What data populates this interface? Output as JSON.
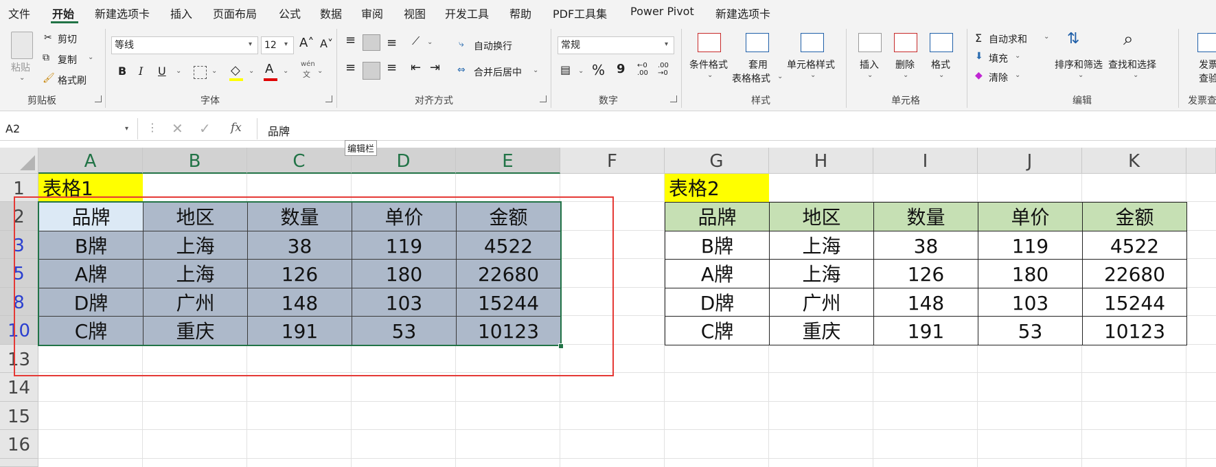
{
  "menu": {
    "tabs": [
      "文件",
      "开始",
      "新建选项卡",
      "插入",
      "页面布局",
      "公式",
      "数据",
      "审阅",
      "视图",
      "开发工具",
      "帮助",
      "PDF工具集",
      "Power Pivot",
      "新建选项卡"
    ],
    "active": "开始"
  },
  "ribbon": {
    "clipboard": {
      "paste": "粘贴",
      "cut": "剪切",
      "copy": "复制",
      "painter": "格式刷",
      "label": "剪贴板"
    },
    "font": {
      "name": "等线",
      "size": "12",
      "label": "字体",
      "bold": "B",
      "italic": "I",
      "underline": "U",
      "phonetic_top": "wén",
      "phonetic_bottom": "文",
      "font_color_letter": "A"
    },
    "align": {
      "wrap": "自动换行",
      "merge": "合并后居中",
      "label": "对齐方式"
    },
    "number": {
      "format": "常规",
      "percent": "%",
      "comma": "9",
      "inc": "←0 .00",
      "dec": ".00 →0",
      "label": "数字"
    },
    "styles": {
      "cond": "条件格式",
      "table_top": "套用",
      "table_bottom": "表格格式",
      "cell": "单元格样式",
      "label": "样式"
    },
    "cells": {
      "insert": "插入",
      "delete": "删除",
      "format": "格式",
      "label": "单元格"
    },
    "editing": {
      "autosum": "自动求和",
      "fill": "填充",
      "clear": "清除",
      "sort": "排序和筛选",
      "find": "查找和选择",
      "label": "编辑"
    },
    "invoice": {
      "top": "发票",
      "mid": "查验",
      "label": "发票查"
    }
  },
  "formula_bar": {
    "name_box": "A2",
    "fx": "fx",
    "value": "品牌",
    "tooltip": "编辑栏"
  },
  "columns": [
    "A",
    "B",
    "C",
    "D",
    "E",
    "F",
    "G",
    "H",
    "I",
    "J",
    "K"
  ],
  "rows": [
    "1",
    "2",
    "3",
    "5",
    "8",
    "10",
    "13",
    "14",
    "15",
    "16"
  ],
  "table1": {
    "title": "表格1",
    "headers": [
      "品牌",
      "地区",
      "数量",
      "单价",
      "金额"
    ],
    "rows": [
      [
        "B牌",
        "上海",
        "38",
        "119",
        "4522"
      ],
      [
        "A牌",
        "上海",
        "126",
        "180",
        "22680"
      ],
      [
        "D牌",
        "广州",
        "148",
        "103",
        "15244"
      ],
      [
        "C牌",
        "重庆",
        "191",
        "53",
        "10123"
      ]
    ]
  },
  "table2": {
    "title": "表格2",
    "headers": [
      "品牌",
      "地区",
      "数量",
      "单价",
      "金额"
    ],
    "rows": [
      [
        "B牌",
        "上海",
        "38",
        "119",
        "4522"
      ],
      [
        "A牌",
        "上海",
        "126",
        "180",
        "22680"
      ],
      [
        "D牌",
        "广州",
        "148",
        "103",
        "15244"
      ],
      [
        "C牌",
        "重庆",
        "191",
        "53",
        "10123"
      ]
    ]
  },
  "colors": {
    "accent": "#217346",
    "table1_fill": "#adb9ca",
    "table2_header": "#c6e0b4",
    "title_fill": "#ffff00",
    "highlight_box": "#e53935"
  }
}
